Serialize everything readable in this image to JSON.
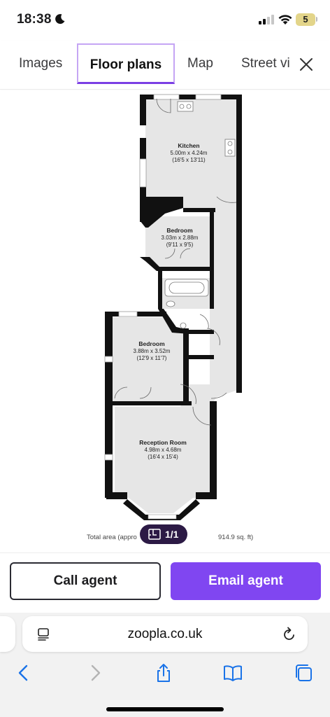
{
  "status_bar": {
    "time": "18:38",
    "battery": "5"
  },
  "tabs": [
    {
      "label": "Images"
    },
    {
      "label": "Floor plans"
    },
    {
      "label": "Map"
    },
    {
      "label": "Street vi"
    }
  ],
  "floor_plan": {
    "rooms": [
      {
        "name": "Kitchen",
        "metric": "5.00m x 4.24m",
        "imperial": "(16'5 x 13'11)"
      },
      {
        "name": "Bedroom",
        "metric": "3.03m x 2.88m",
        "imperial": "(9'11 x 9'5)"
      },
      {
        "name": "Bedroom",
        "metric": "3.88m x 3.52m",
        "imperial": "(12'9 x 11'7)"
      },
      {
        "name": "Reception Room",
        "metric": "4.98m x 4.68m",
        "imperial": "(16'4 x 15'4)"
      }
    ],
    "total_area_left": "Total area (appro",
    "total_area_right": "914.9 sq. ft)",
    "counter": "1/1"
  },
  "actions": {
    "call": "Call agent",
    "email": "Email agent"
  },
  "browser": {
    "url": "zoopla.co.uk"
  },
  "colors": {
    "accent": "#8046f1",
    "tab_underline": "#7a3fe4",
    "pill": "#2c1a45"
  }
}
